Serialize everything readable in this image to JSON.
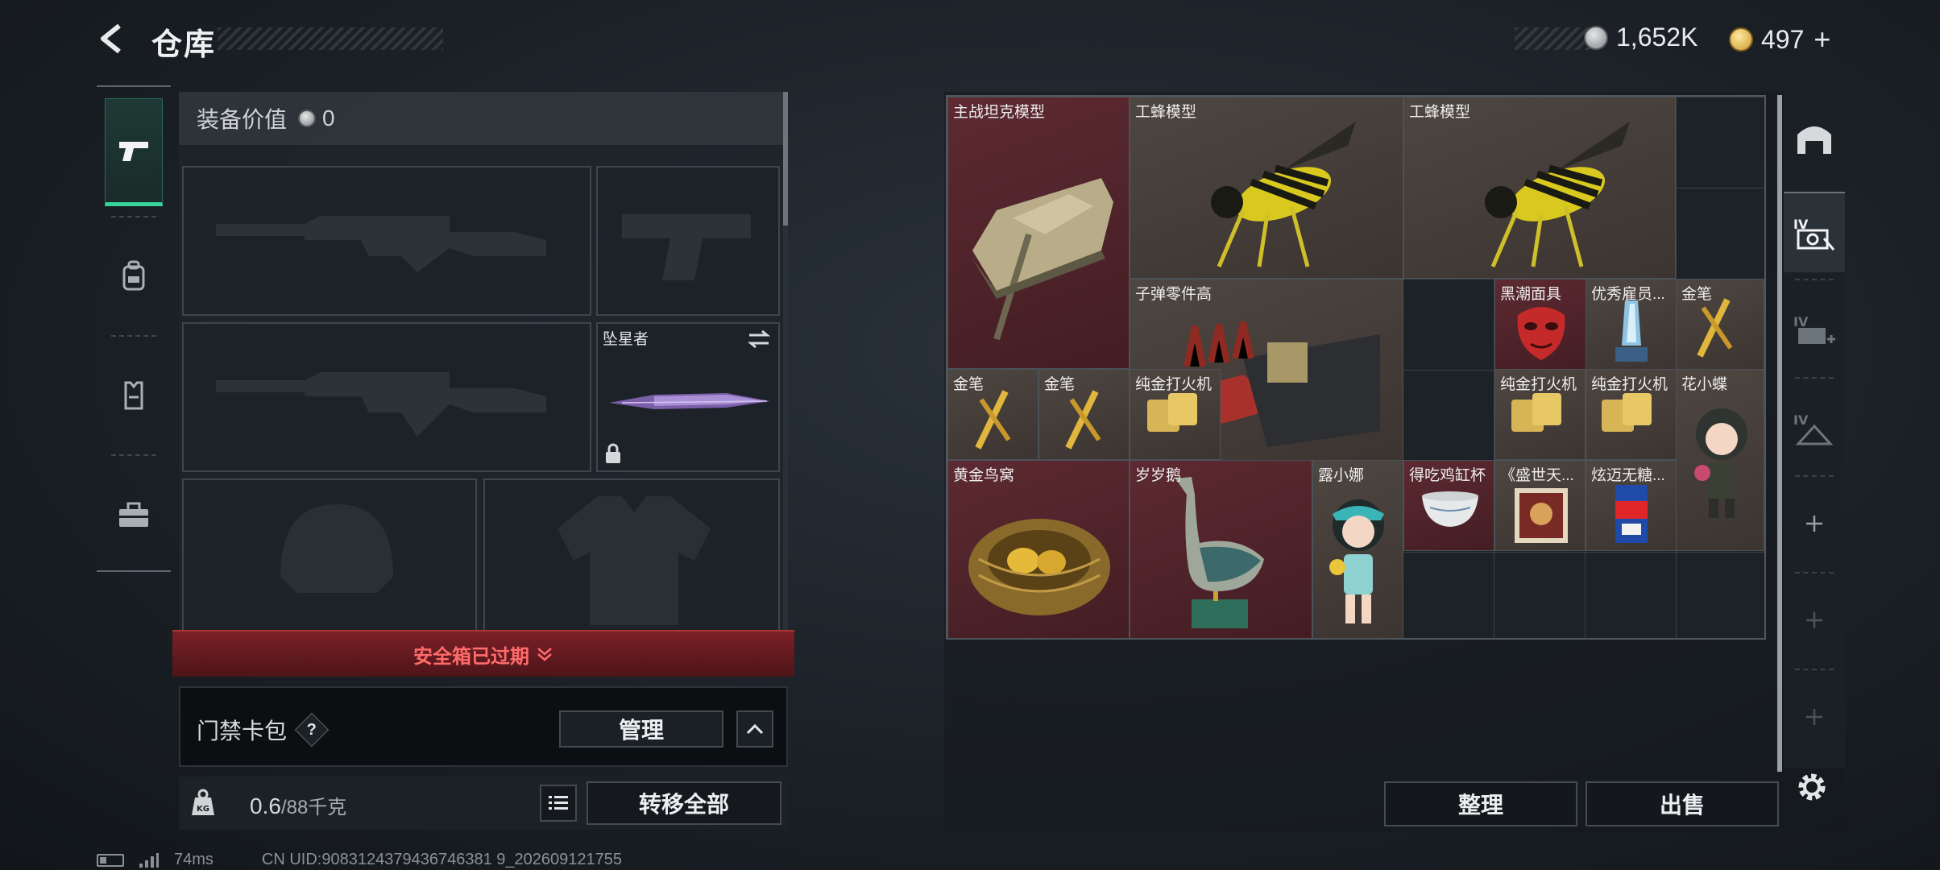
{
  "header": {
    "title": "仓库",
    "currency_silver": "1,652K",
    "currency_gold": "497",
    "gold_plus": "+"
  },
  "equipment": {
    "value_label": "装备价值",
    "value": "0",
    "melee_slot_label": "坠星者",
    "expired_text": "安全箱已过期",
    "keybag_label": "门禁卡包",
    "keybag_help": "?",
    "manage_label": "管理",
    "weight_current": "0.6",
    "weight_capacity": "/88千克",
    "transfer_all_label": "转移全部"
  },
  "storage": {
    "items": [
      {
        "name": "主战坦克模型",
        "rarity": "red",
        "icon": "tank-icon"
      },
      {
        "name": "工蜂模型",
        "rarity": "gold",
        "icon": "wasp-icon"
      },
      {
        "name": "工蜂模型",
        "rarity": "gold",
        "icon": "wasp-icon"
      },
      {
        "name": "子弹零件高",
        "rarity": "gold",
        "icon": "ammo-parts-icon"
      },
      {
        "name": "黑潮面具",
        "rarity": "red",
        "icon": "mask-icon"
      },
      {
        "name": "优秀雇员...",
        "rarity": "gold",
        "icon": "trophy-icon"
      },
      {
        "name": "金笔",
        "rarity": "gold",
        "icon": "gold-pen-icon"
      },
      {
        "name": "金笔",
        "rarity": "gold",
        "icon": "gold-pen-icon"
      },
      {
        "name": "金笔",
        "rarity": "gold",
        "icon": "gold-pen-icon"
      },
      {
        "name": "纯金打火机",
        "rarity": "gold",
        "icon": "lighter-icon"
      },
      {
        "name": "纯金打火机",
        "rarity": "gold",
        "icon": "lighter-icon"
      },
      {
        "name": "纯金打火机",
        "rarity": "gold",
        "icon": "lighter-icon"
      },
      {
        "name": "花小蝶",
        "rarity": "gold",
        "icon": "figurine-icon"
      },
      {
        "name": "黄金鸟窝",
        "rarity": "red",
        "icon": "golden-nest-icon"
      },
      {
        "name": "岁岁鹅",
        "rarity": "red",
        "icon": "goose-statue-icon"
      },
      {
        "name": "露小娜",
        "rarity": "gold",
        "icon": "figurine-icon"
      },
      {
        "name": "得吃鸡缸杯",
        "rarity": "red",
        "icon": "cup-icon"
      },
      {
        "name": "《盛世天...",
        "rarity": "gold",
        "icon": "book-icon"
      },
      {
        "name": "炫迈无糖...",
        "rarity": "gold",
        "icon": "gum-icon"
      }
    ],
    "sort_label": "整理",
    "sell_label": "出售"
  },
  "status": {
    "ping": "74ms",
    "uid": "CN UID:9083124379436746381 9_202609121755"
  },
  "colors": {
    "accent": "#35d49a",
    "expired": "#ff6b6b",
    "red_rarity": "#5d2a31",
    "gold_rarity": "#4d4641"
  }
}
